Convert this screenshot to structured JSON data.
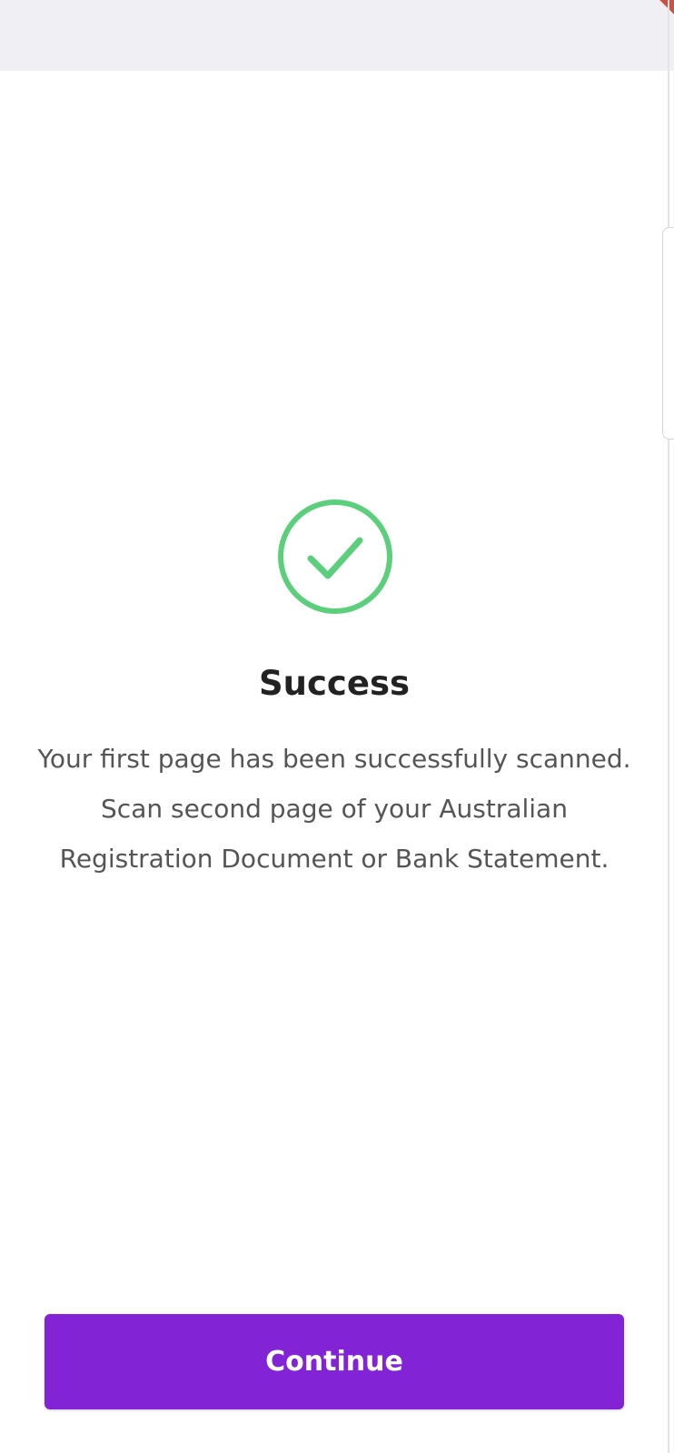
{
  "header": {
    "background_color": "#efeff4"
  },
  "status": {
    "icon": "check-circle-icon",
    "icon_color": "#5ccf7c"
  },
  "content": {
    "title": "Success",
    "message": "Your first page has been successfully scanned. Scan second page of your Australian Registration Document or Bank Statement."
  },
  "actions": {
    "continue_label": "Continue",
    "accent_color": "#8224d5"
  }
}
